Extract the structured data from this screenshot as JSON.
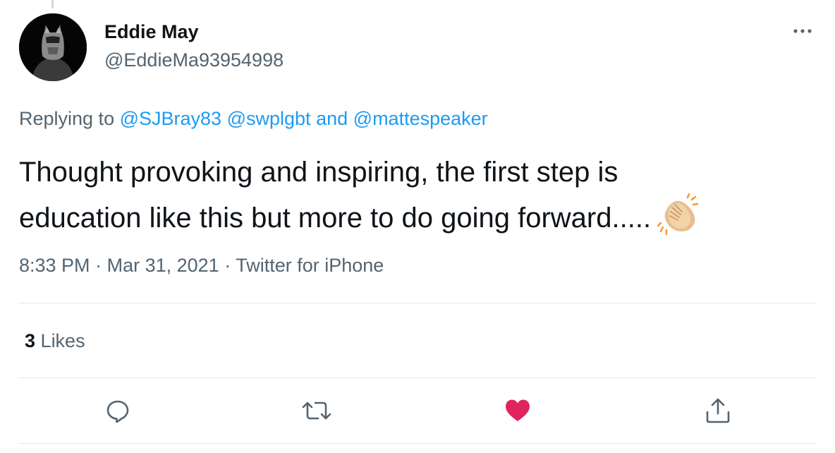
{
  "tweet": {
    "author": {
      "display_name": "Eddie May",
      "handle": "@EddieMa93954998",
      "avatar_icon": "batman-avatar"
    },
    "reply_to": {
      "prefix": "Replying to",
      "mentions": [
        "@SJBray83",
        "@swplgbt",
        "@mattespeaker"
      ],
      "conjunction": "and"
    },
    "text_line1": "Thought provoking and inspiring, the first step is",
    "text_line2": "education like this but more to do going forward.....",
    "emoji": "clapping-hands-icon",
    "time": "8:33 PM",
    "separator": "·",
    "date": "Mar 31, 2021",
    "source": "Twitter for iPhone",
    "likes_count": "3",
    "likes_label": "Likes",
    "liked": true
  },
  "actions": {
    "reply_icon": "reply-icon",
    "retweet_icon": "retweet-icon",
    "like_icon": "heart-icon",
    "share_icon": "share-icon",
    "more_icon": "more-icon"
  },
  "colors": {
    "text_primary": "#0f1419",
    "text_secondary": "#536471",
    "link": "#1d9bf0",
    "like_active": "#e0245e",
    "divider": "#e3e8eb"
  }
}
